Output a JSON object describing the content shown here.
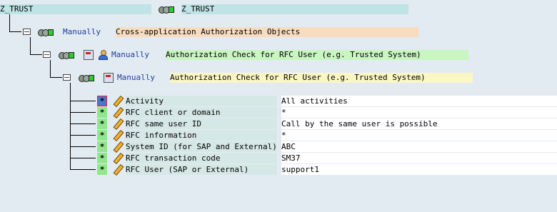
{
  "root": {
    "label_left": "Z_TRUST",
    "label_right": "Z_TRUST"
  },
  "level1": {
    "status": "Manually",
    "text": "Cross-application Authorization Objects"
  },
  "level2": {
    "status": "Manually",
    "text": "Authorization Check for RFC User (e.g. Trusted System)"
  },
  "level3": {
    "status": "Manually",
    "text": "Authorization Check for RFC User (e.g. Trusted System)"
  },
  "fields": [
    {
      "star": "*",
      "name": "Activity",
      "value": "All activities"
    },
    {
      "star": "*",
      "name": "RFC client or domain",
      "value": "*"
    },
    {
      "star": "*",
      "name": "RFC same user ID",
      "value": "Call by the same user is possible"
    },
    {
      "star": "*",
      "name": "RFC information",
      "value": "*"
    },
    {
      "star": "*",
      "name": "System ID (for SAP and External)",
      "value": "ABC"
    },
    {
      "star": "*",
      "name": "RFC transaction code",
      "value": "SM37"
    },
    {
      "star": "*",
      "name": "RFC User (SAP or External)",
      "value": "support1"
    }
  ]
}
